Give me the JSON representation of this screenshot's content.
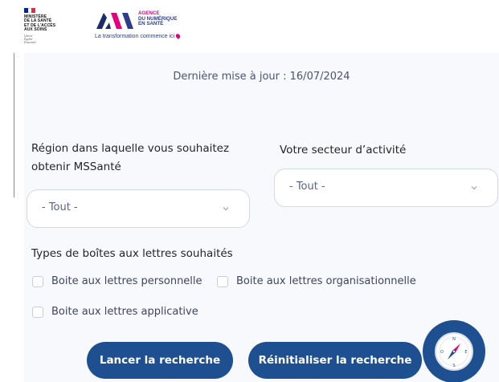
{
  "header": {
    "gov_logo": {
      "lines": [
        "MINISTÈRE",
        "DE LA SANTÉ",
        "ET DE L'ACCÈS",
        "AUX SOINS"
      ],
      "motto": [
        "Liberté",
        "Égalité",
        "Fraternité"
      ],
      "flag_colors": [
        "#002395",
        "#ffffff",
        "#ed2939"
      ]
    },
    "ans_logo": {
      "lines": [
        "AGENCE",
        "DU NUMÉRIQUE",
        "EN SANTÉ"
      ],
      "line_colors": [
        "#e6007e",
        "#2d3d8e",
        "#2d3d8e"
      ],
      "tagline": "La transformation commence ici"
    }
  },
  "update_text": "Dernière mise à jour : 16/07/2024",
  "form": {
    "region_label": "Région dans laquelle vous souhaitez obtenir MSSanté",
    "region_value": "- Tout -",
    "sector_label": "Votre secteur d’activité",
    "sector_value": "- Tout -",
    "types_label": "Types de boîtes aux lettres souhaités",
    "checkboxes": [
      {
        "label": "Boite aux lettres personnelle",
        "checked": false
      },
      {
        "label": "Boite aux lettres organisationnelle",
        "checked": false
      },
      {
        "label": "Boite aux lettres applicative",
        "checked": false
      }
    ]
  },
  "buttons": {
    "search": "Lancer la recherche",
    "reset": "Réinitialiser la recherche"
  },
  "floating": {
    "icon": "compass-icon"
  },
  "colors": {
    "primary": "#1d4f91",
    "panel_bg": "#f7f9fc",
    "ans_pink": "#e6007e",
    "ans_navy": "#2d3d8e"
  }
}
